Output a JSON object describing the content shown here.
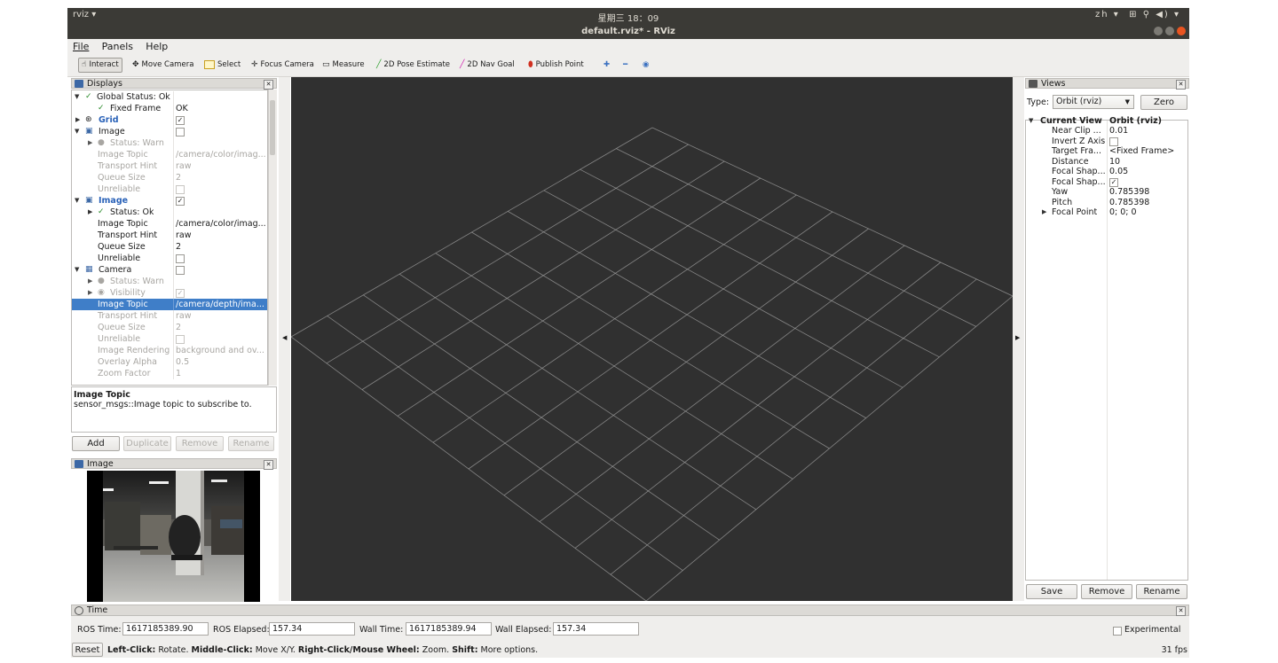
{
  "topbar": {
    "app_menu": "rviz ▾",
    "clock": "星期三 18：09",
    "lang": "zh ▾",
    "indicators": "⊞  ⚲  ◀) ▾"
  },
  "window": {
    "title": "default.rviz* - RViz"
  },
  "menu": [
    "File",
    "Panels",
    "Help"
  ],
  "toolbar": {
    "interact": "Interact",
    "move_camera": "Move Camera",
    "select": "Select",
    "focus_camera": "Focus Camera",
    "measure": "Measure",
    "pose_estimate": "2D Pose Estimate",
    "nav_goal": "2D Nav Goal",
    "publish_point": "Publish Point"
  },
  "displays": {
    "title": "Displays",
    "rows": [
      {
        "key": "Global Status: Ok",
        "value": ""
      },
      {
        "key": "Fixed Frame",
        "value": "OK"
      },
      {
        "key": "Grid",
        "value": "✓"
      },
      {
        "key": "Image",
        "value": ""
      },
      {
        "key": "Status: Warn",
        "value": ""
      },
      {
        "key": "Image Topic",
        "value": "/camera/color/imag..."
      },
      {
        "key": "Transport Hint",
        "value": "raw"
      },
      {
        "key": "Queue Size",
        "value": "2"
      },
      {
        "key": "Unreliable",
        "value": ""
      },
      {
        "key": "Image",
        "value": "✓"
      },
      {
        "key": "Status: Ok",
        "value": ""
      },
      {
        "key": "Image Topic",
        "value": "/camera/color/imag..."
      },
      {
        "key": "Transport Hint",
        "value": "raw"
      },
      {
        "key": "Queue Size",
        "value": "2"
      },
      {
        "key": "Unreliable",
        "value": ""
      },
      {
        "key": "Camera",
        "value": ""
      },
      {
        "key": "Status: Warn",
        "value": ""
      },
      {
        "key": "Visibility",
        "value": "✓"
      },
      {
        "key": "Image Topic",
        "value": "/camera/depth/ima..."
      },
      {
        "key": "Transport Hint",
        "value": "raw"
      },
      {
        "key": "Queue Size",
        "value": "2"
      },
      {
        "key": "Unreliable",
        "value": ""
      },
      {
        "key": "Image Rendering",
        "value": "background and ov..."
      },
      {
        "key": "Overlay Alpha",
        "value": "0.5"
      },
      {
        "key": "Zoom Factor",
        "value": "1"
      }
    ],
    "description_title": "Image Topic",
    "description_text": "sensor_msgs::Image topic to subscribe to.",
    "buttons": {
      "add": "Add",
      "duplicate": "Duplicate",
      "remove": "Remove",
      "rename": "Rename"
    }
  },
  "image_panel": {
    "title": "Image"
  },
  "views": {
    "title": "Views",
    "type_label": "Type:",
    "type_value": "Orbit (rviz)",
    "zero": "Zero",
    "rows": [
      {
        "key": "Current View",
        "value": "Orbit (rviz)"
      },
      {
        "key": "Near Clip ...",
        "value": "0.01"
      },
      {
        "key": "Invert Z Axis",
        "value": ""
      },
      {
        "key": "Target Fra...",
        "value": "<Fixed Frame>"
      },
      {
        "key": "Distance",
        "value": "10"
      },
      {
        "key": "Focal Shap...",
        "value": "0.05"
      },
      {
        "key": "Focal Shap...",
        "value": "✓"
      },
      {
        "key": "Yaw",
        "value": "0.785398"
      },
      {
        "key": "Pitch",
        "value": "0.785398"
      },
      {
        "key": "Focal Point",
        "value": "0; 0; 0"
      }
    ],
    "buttons": {
      "save": "Save",
      "remove": "Remove",
      "rename": "Rename"
    }
  },
  "time": {
    "title": "Time",
    "ros_time_label": "ROS Time:",
    "ros_time": "1617185389.90",
    "ros_elapsed_label": "ROS Elapsed:",
    "ros_elapsed": "157.34",
    "wall_time_label": "Wall Time:",
    "wall_time": "1617185389.94",
    "wall_elapsed_label": "Wall Elapsed:",
    "wall_elapsed": "157.34",
    "experimental": "Experimental"
  },
  "statusbar": {
    "reset": "Reset",
    "hint_1": "Left-Click:",
    "hint_1b": " Rotate. ",
    "hint_2": "Middle-Click:",
    "hint_2b": " Move X/Y. ",
    "hint_3": "Right-Click/Mouse Wheel:",
    "hint_3b": " Zoom. ",
    "hint_4": "Shift:",
    "hint_4b": " More options.",
    "fps": "31 fps"
  },
  "colors": {
    "viewport": "#303030",
    "grid": "#a0a0a0",
    "selection": "#3f7ec8",
    "chrome": "#3b3a36",
    "close_button": "#e95420"
  }
}
